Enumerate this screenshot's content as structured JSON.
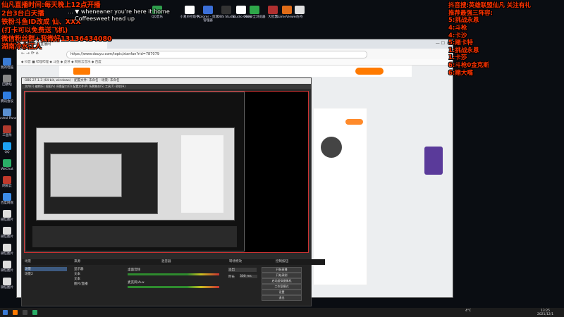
{
  "overlay_left": {
    "lines": [
      "仙凡直播时间:每天晚上12点开播",
      "2台3台白天播",
      "铁粉斗鱼ID改成 仙、XXX",
      "(打卡可以免费送飞机)",
      "微信粉丝群+我微好13136434080",
      "湖南冷水江人"
    ]
  },
  "overlay_right": {
    "lines": [
      "抖音搜:英雄联盟仙凡 关注有礼",
      "推荐最强三阵容:",
      "5:挑战永恩",
      "4:斗枪",
      "4:卡沙",
      "5:赌卡特",
      "1:挑战永恩",
      "1:卡莎",
      "6:斗枪0金克斯",
      "6:赌大嘴"
    ]
  },
  "overlay_center": {
    "lines": [
      "... ▼ wheneaner you're here it home",
      "... Coffeesweet head up"
    ]
  },
  "desktop_icons_top": [
    {
      "label": "QQ音乐",
      "color": "#2f9e4c"
    },
    {
      "label": "小易声控助手",
      "color": "#ffffff"
    },
    {
      "label": "Xplorer - 资源管理器",
      "color": "#3b6fd8"
    },
    {
      "label": "OBS Studio",
      "color": "#333333"
    },
    {
      "label": "Studio One",
      "color": "#ffffff"
    },
    {
      "label": "360安全浏览器",
      "color": "#2fa84a"
    },
    {
      "label": "大智慧",
      "color": "#b03030"
    },
    {
      "label": "GameViewer",
      "color": "#e06c18"
    },
    {
      "label": "方舟",
      "color": "#e0e0e0"
    }
  ],
  "desktop_icons_left": [
    {
      "label": "我的电脑",
      "color": "#3a7bd5"
    },
    {
      "label": "回收站",
      "color": "#888888"
    },
    {
      "label": "腾讯会议",
      "color": "#2f7de1"
    },
    {
      "label": "Control Panel",
      "color": "#5a8fd0"
    },
    {
      "label": "三国杀",
      "color": "#b03a2e"
    },
    {
      "label": "QQ",
      "color": "#1da1f2"
    },
    {
      "label": "WeChat",
      "color": "#2aae67"
    },
    {
      "label": "网易云",
      "color": "#c0392b"
    },
    {
      "label": "百度网盘",
      "color": "#3c8ce7"
    },
    {
      "label": "微信图片",
      "color": "#dddddd"
    },
    {
      "label": "微信图片",
      "color": "#dddddd"
    },
    {
      "label": "微信图片",
      "color": "#dddddd"
    },
    {
      "label": "微信图片",
      "color": "#dddddd"
    },
    {
      "label": "微信图片",
      "color": "#dddddd"
    }
  ],
  "browser": {
    "tab_title": "斗鱼 - 仙凡直播间",
    "url": "https://www.douyu.com/topic/xianfan?rid=787079",
    "bookmarks": "◆ 抖音  ■ 哔哩哔哩  ◆ 斗鱼  ◆ 虎牙  ◆ 网易云音乐  ◆ 百度"
  },
  "obs": {
    "title": "OBS 27.1.3 (64-bit, windows) - 配置文件: 未命名 - 场景: 未命名",
    "menu": "文件(F)  编辑(E)  视图(V)  停靠窗口(D)  配置文件(P)  场景集合(S)  工具(T)  帮助(H)",
    "dock_headers": [
      "场景",
      "来源",
      "混音器",
      "转场特效",
      "控制按钮"
    ],
    "scenes": [
      "场景",
      "场景2"
    ],
    "sources": [
      "显示器",
      "文本",
      "文本",
      "图片/直播"
    ],
    "mixer_labels": [
      "桌面音频",
      "麦克风/Aux"
    ],
    "transition": {
      "type": "淡出",
      "duration_label": "时长",
      "duration": "300 ms"
    },
    "controls": [
      "开始直播",
      "开始录制",
      "启动虚拟摄像机",
      "工作室模式",
      "设置",
      "退出"
    ]
  },
  "taskbar": {
    "items": [
      "斗鱼",
      "OBS",
      "微信"
    ],
    "time": "13:25",
    "date": "2021/12/1",
    "weather": "4°C"
  }
}
